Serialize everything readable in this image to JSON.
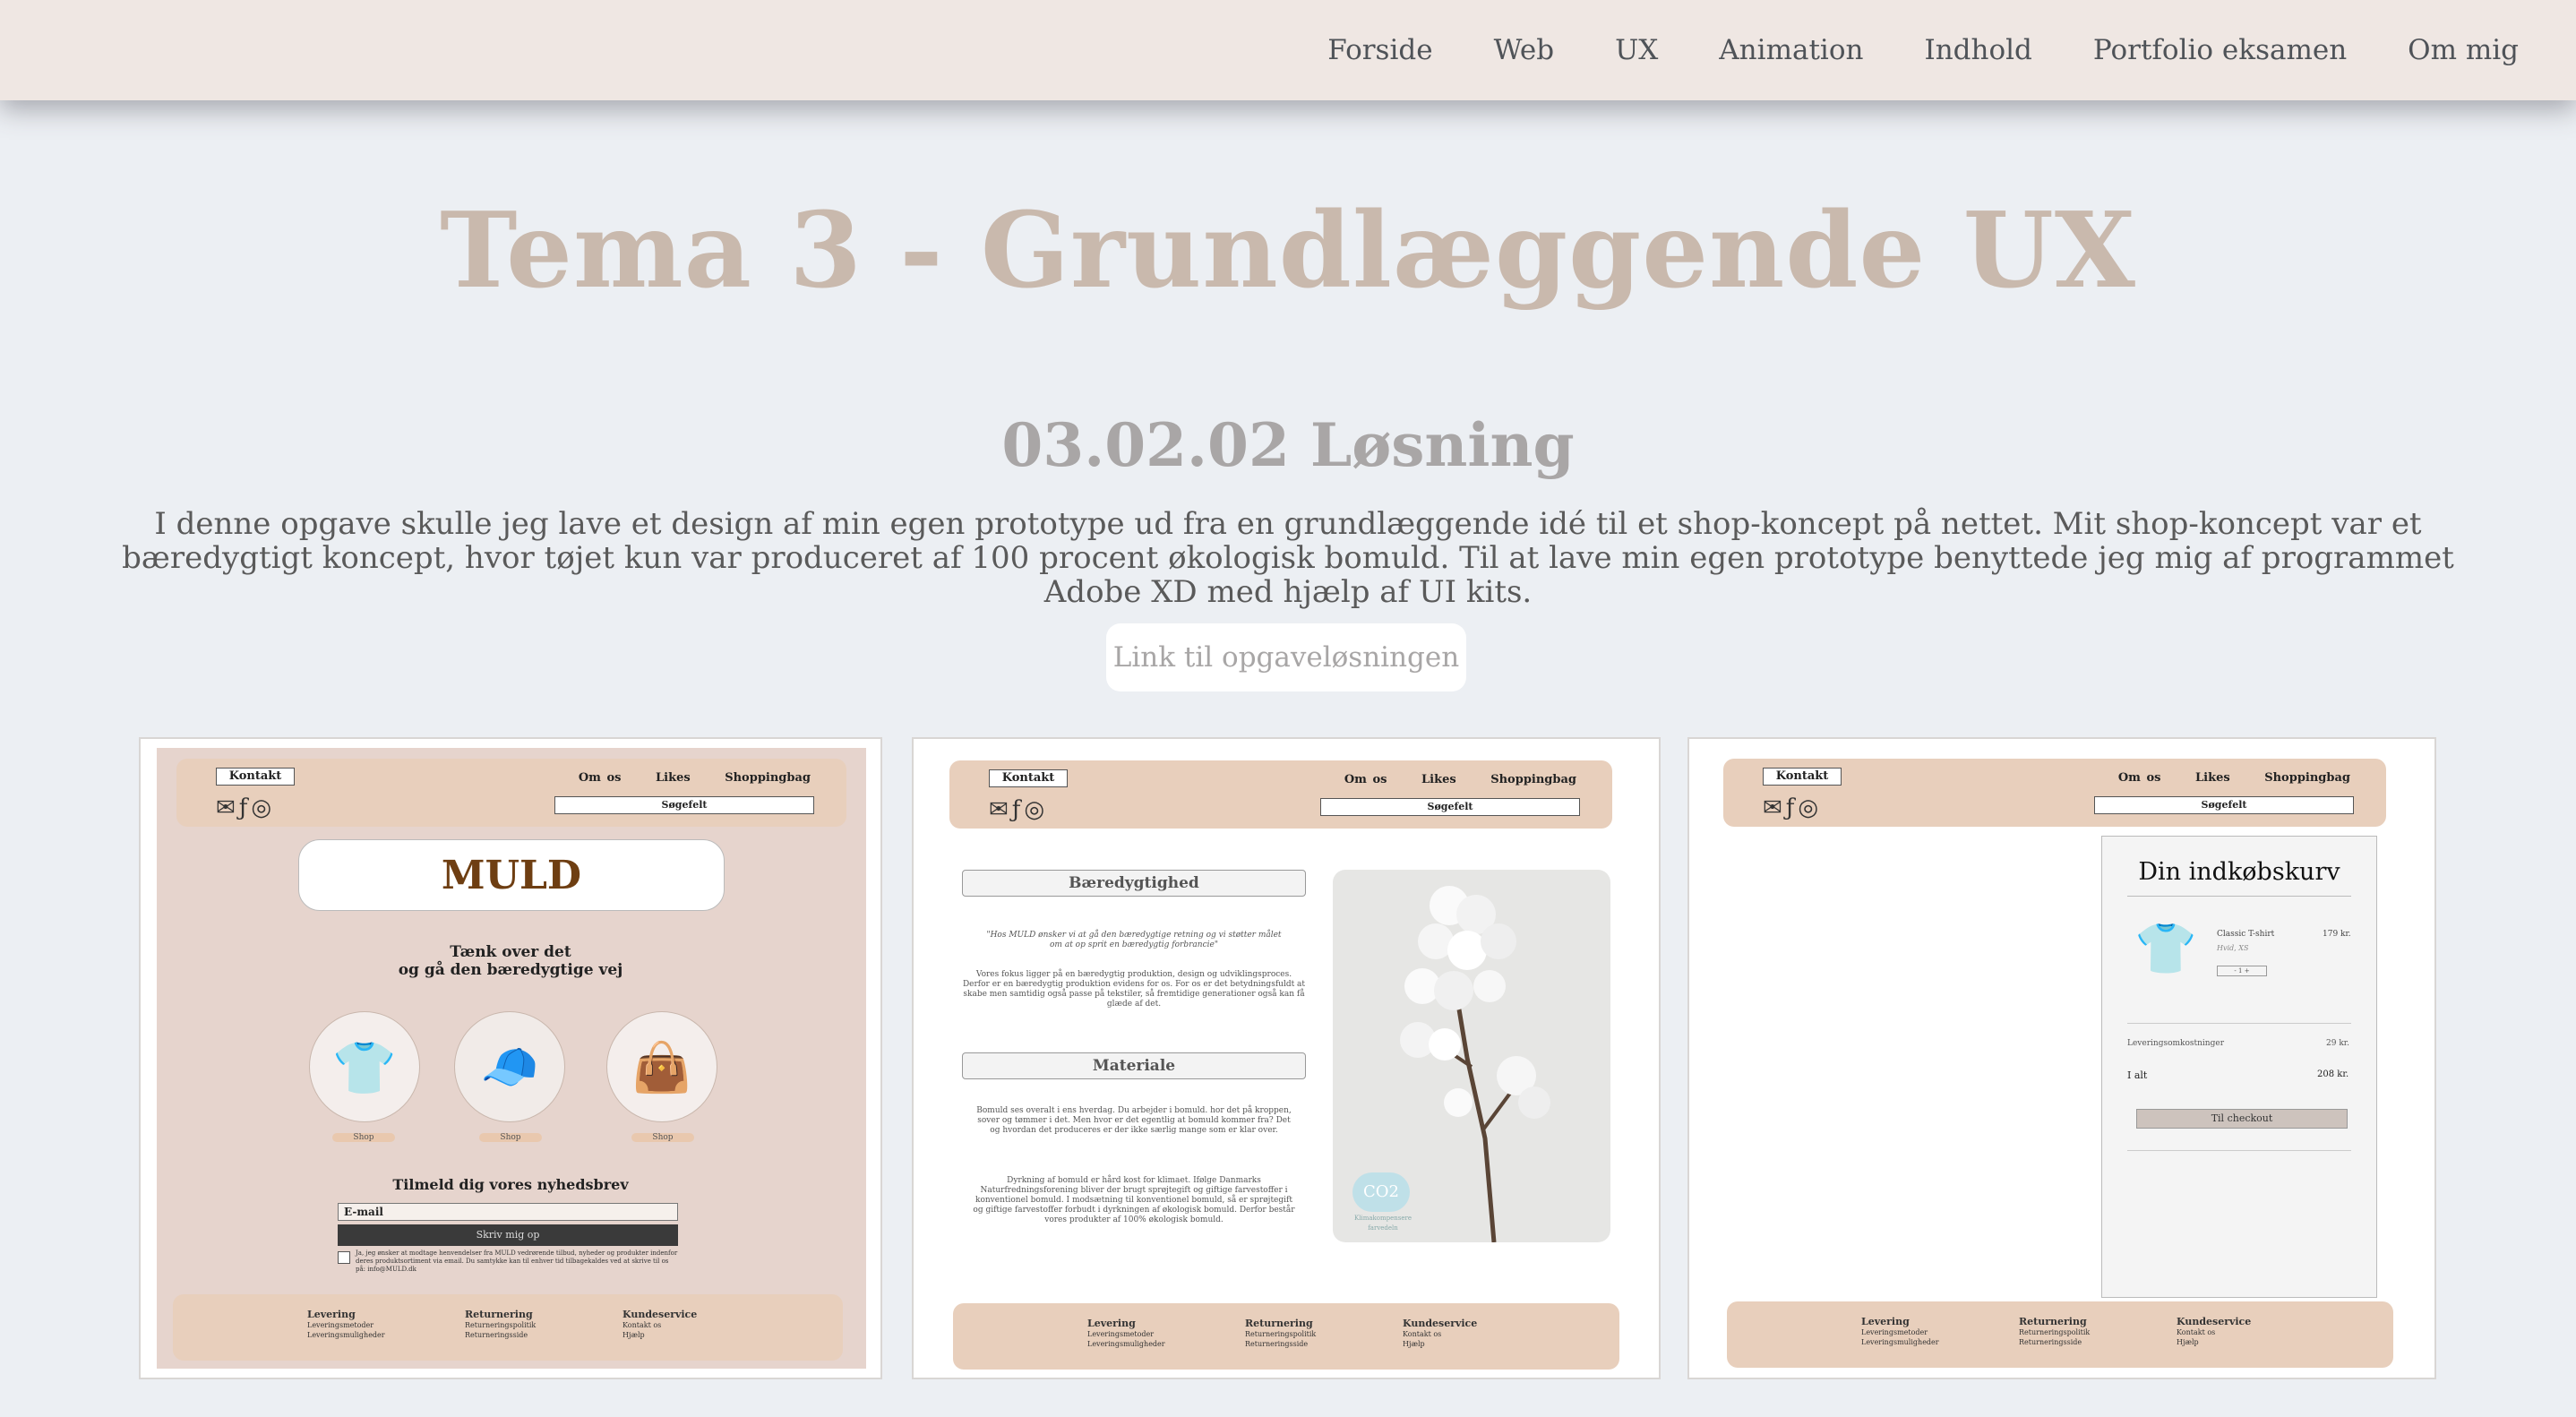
{
  "nav": {
    "items": [
      "Forside",
      "Web",
      "UX",
      "Animation",
      "Indhold",
      "Portfolio eksamen",
      "Om mig"
    ]
  },
  "hero": {
    "title": "Tema 3 - Grundlæggende UX",
    "subtitle": "03.02.02 Løsning",
    "intro": "I denne opgave skulle jeg lave et design af min egen prototype ud fra en grundlæggende idé til et shop-koncept på nettet. Mit shop-koncept var et bæredygtigt koncept, hvor tøjet kun var produceret af 100 procent økologisk bomuld. Til at lave min egen prototype benyttede jeg mig af programmet Adobe XD med hjælp af UI kits.",
    "link_label": "Link til opgaveløsningen"
  },
  "mockup": {
    "header": {
      "contact": "Kontakt",
      "about": "Om os",
      "likes": "Likes",
      "bag": "Shoppingbag",
      "search": "Søgefelt"
    },
    "footer": {
      "col1": {
        "title": "Levering",
        "l1": "Leveringsmetoder",
        "l2": "Leveringsmuligheder"
      },
      "col2": {
        "title": "Returnering",
        "l1": "Returneringspolitik",
        "l2": "Returneringsside"
      },
      "col3": {
        "title": "Kundeservice",
        "l1": "Kontakt os",
        "l2": "Hjælp"
      }
    },
    "home": {
      "brand": "MULD",
      "tagline1": "Tænk over det",
      "tagline2": "og gå den bæredygtige vej",
      "shop": "Shop",
      "newsletter": "Tilmeld dig vores nyhedsbrev",
      "email": "E-mail",
      "signup": "Skriv mig op",
      "consent": "Ja, jeg ønsker at modtage henvendelser fra MULD vedrørende tilbud, nyheder og produkter indenfor deres produktsortiment via email. Du samtykke kan til enhver tid tilbagekaldes ved at skrive til os på: info@MULD.dk"
    },
    "about": {
      "h1": "Bæredygtighed",
      "quote": "\"Hos MULD ønsker vi at gå den bæredygtige retning og vi støtter målet om at op sprit en bæredygtig forbrancie\"",
      "p1": "Vores fokus ligger på en bæredygtig produktion, design og udviklingsproces. Derfor er en bæredygtig produktion evidens for os. For os er det betydningsfuldt at skabe men samtidig også passe på tekstiler, så fremtidige generationer også kan få glæde af det.",
      "h2": "Materiale",
      "p2": "Bomuld ses overalt i ens hverdag. Du arbejder i bomuld. hor det på kroppen, sover og tømmer i det. Men hvor er det egentlig at bomuld kommer fra? Det og hvordan det produceres er der ikke særlig mange som er klar over.",
      "p3": "Dyrkning af bomuld er hård kost for klimaet. Ifølge Danmarks Naturfredningsforening bliver der brugt sprøjtegift og giftige farvestoffer i konventionel bomuld. I modsætning til konventionel bomuld, så er sprøjtegift og giftige farvestoffer forbudt i dyrkningen af økologisk bomuld. Derfor består vores produkter af 100% økologisk bomuld.",
      "co2": "CO2",
      "co2_sub": "Klimakompensere farvedeln"
    },
    "cart": {
      "title": "Din indkøbskurv",
      "item": "Classic T-shirt",
      "item_sub": "Hvid, XS",
      "item_price": "179 kr.",
      "qty": "- 1 +",
      "ship_label": "Leveringsomkostninger",
      "ship_price": "29 kr.",
      "total_label": "I alt",
      "total_price": "208 kr.",
      "checkout": "Til checkout"
    }
  }
}
